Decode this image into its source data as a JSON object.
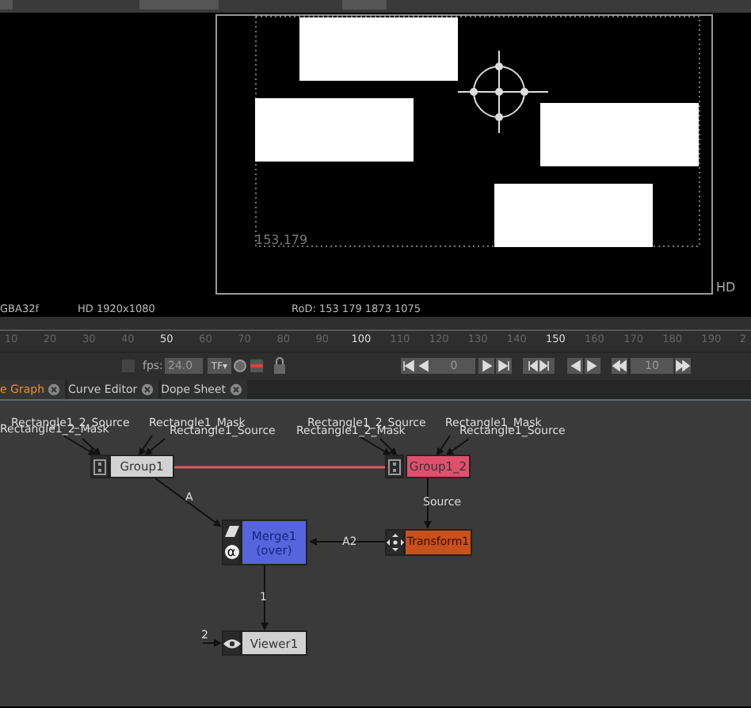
{
  "viewer": {
    "coord_label": "153,179",
    "format_label": "HD"
  },
  "status_bar": {
    "channels": "GBA32f",
    "format": "HD 1920x1080",
    "rod": "RoD: 153 179 1873 1075"
  },
  "timeline": {
    "ticks": [
      {
        "label": "10",
        "highlighted": false
      },
      {
        "label": "20",
        "highlighted": false
      },
      {
        "label": "30",
        "highlighted": false
      },
      {
        "label": "40",
        "highlighted": false
      },
      {
        "label": "50",
        "highlighted": true
      },
      {
        "label": "60",
        "highlighted": false
      },
      {
        "label": "70",
        "highlighted": false
      },
      {
        "label": "80",
        "highlighted": false
      },
      {
        "label": "90",
        "highlighted": false
      },
      {
        "label": "100",
        "highlighted": true
      },
      {
        "label": "110",
        "highlighted": false
      },
      {
        "label": "120",
        "highlighted": false
      },
      {
        "label": "130",
        "highlighted": false
      },
      {
        "label": "140",
        "highlighted": false
      },
      {
        "label": "150",
        "highlighted": true
      },
      {
        "label": "160",
        "highlighted": false
      },
      {
        "label": "170",
        "highlighted": false
      },
      {
        "label": "180",
        "highlighted": false
      },
      {
        "label": "190",
        "highlighted": false
      },
      {
        "label": "2",
        "highlighted": false
      }
    ]
  },
  "controls": {
    "lock_checked": false,
    "fps_label": "fps:",
    "fps": "24.0",
    "time_format": "TF▾",
    "frame": "0",
    "increment": "10"
  },
  "tabs": [
    {
      "label": "e Graph",
      "selected": true
    },
    {
      "label": "Curve Editor",
      "selected": false
    },
    {
      "label": "Dope Sheet",
      "selected": false
    }
  ],
  "nodes": [
    {
      "kind": "group",
      "label": "Group1",
      "color": "#d2d2d2",
      "inputs": [
        "Rectangle1_2_Source",
        "Rectangle1_2_Mask",
        "Rectangle1_Mask",
        "Rectangle1_Source"
      ]
    },
    {
      "kind": "group",
      "label": "Group1_2",
      "color": "#e0506e",
      "inputs": [
        "Rectangle1_2_Source",
        "Rectangle1_2_Mask",
        "Rectangle1_Mask",
        "Rectangle1_Source"
      ]
    },
    {
      "kind": "merge",
      "label": "Merge1 (over)",
      "color": "#5565dc",
      "alpha_glyph": "α"
    },
    {
      "kind": "transform",
      "label": "Transform1",
      "color": "#c8501c"
    },
    {
      "kind": "viewer",
      "label": "Viewer1",
      "color": "#d2d2d2"
    }
  ],
  "edges": [
    {
      "kind": "link"
    },
    {
      "kind": "pipe",
      "label": "A"
    },
    {
      "kind": "pipe",
      "label": "Source"
    },
    {
      "kind": "pipe",
      "label": "A2"
    },
    {
      "kind": "pipe",
      "label": "1"
    },
    {
      "kind": "pipe",
      "label": "2"
    }
  ]
}
